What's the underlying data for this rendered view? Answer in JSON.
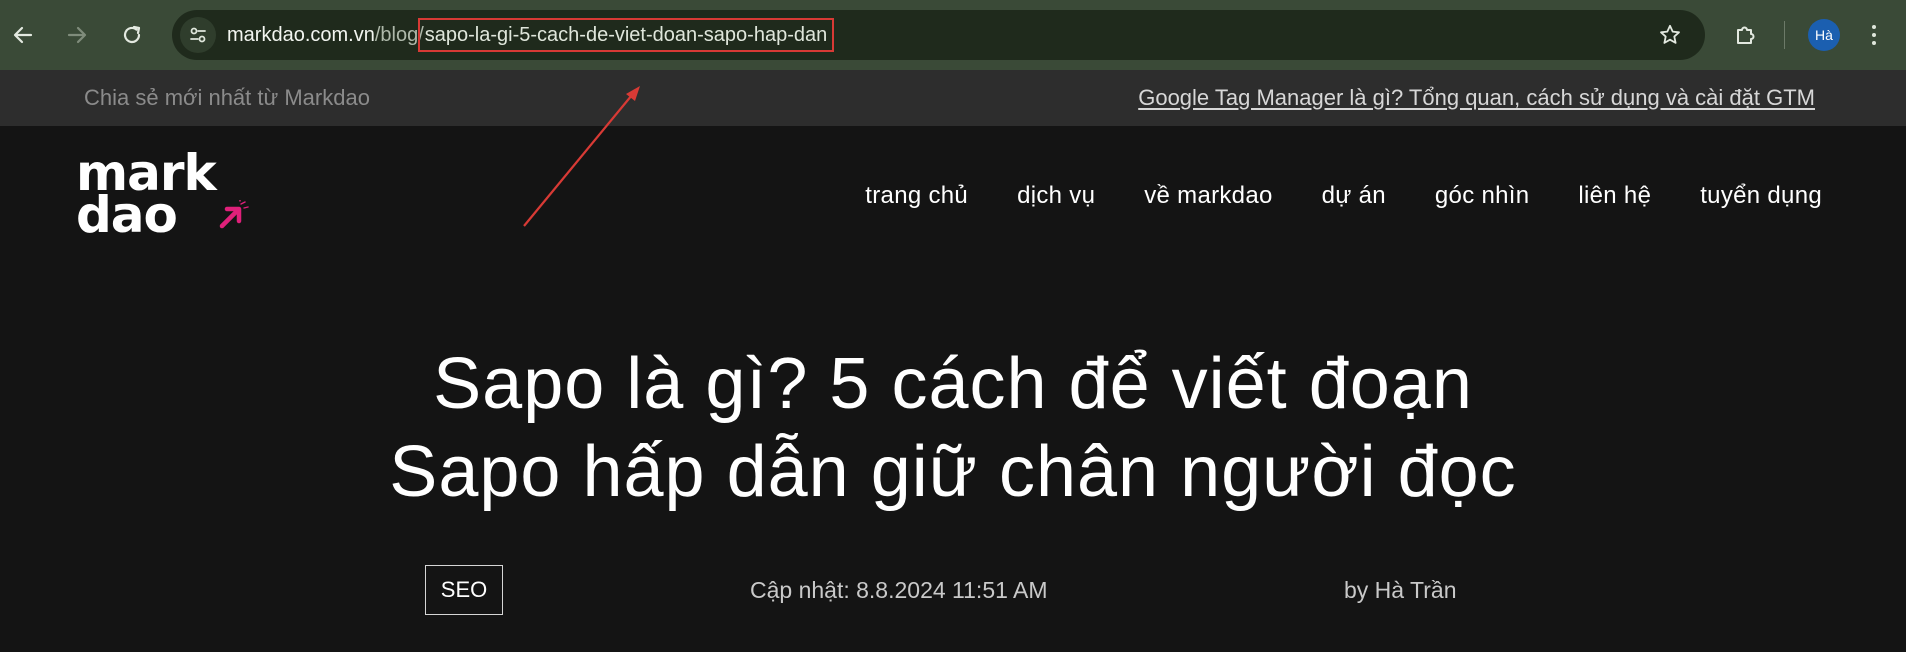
{
  "browser": {
    "url_domain": "markdao.com.vn",
    "url_path_prefix": "/blog/",
    "url_slug": "sapo-la-gi-5-cach-de-viet-doan-sapo-hap-dan",
    "profile_initials": "Hà",
    "icons": {
      "back": "back-arrow-icon",
      "forward": "forward-arrow-icon",
      "reload": "reload-icon",
      "site_info": "tune-icon",
      "bookmark": "star-icon",
      "extensions": "puzzle-icon",
      "menu": "kebab-menu-icon"
    },
    "colors": {
      "toolbar": "#3a4a37",
      "omnibox": "#1f2a1c",
      "highlight_box": "#d83a35",
      "avatar": "#1b5fb0"
    }
  },
  "topbar": {
    "left_text": "Chia sẻ mới nhất từ Markdao",
    "right_link": "Google Tag Manager là gì? Tổng quan, cách sử dụng và cài đặt GTM"
  },
  "header": {
    "logo_line1": "mark",
    "logo_line2": "dao",
    "nav": [
      "trang chủ",
      "dịch vụ",
      "về markdao",
      "dự án",
      "góc nhìn",
      "liên hệ",
      "tuyển dụng"
    ],
    "accent_color": "#e0207a"
  },
  "article": {
    "title_line1": "Sapo là gì? 5 cách để viết đoạn",
    "title_line2": "Sapo hấp dẫn giữ chân người đọc",
    "category": "SEO",
    "updated": "Cập nhật: 8.8.2024 11:51 AM",
    "author": "by Hà Trần"
  }
}
